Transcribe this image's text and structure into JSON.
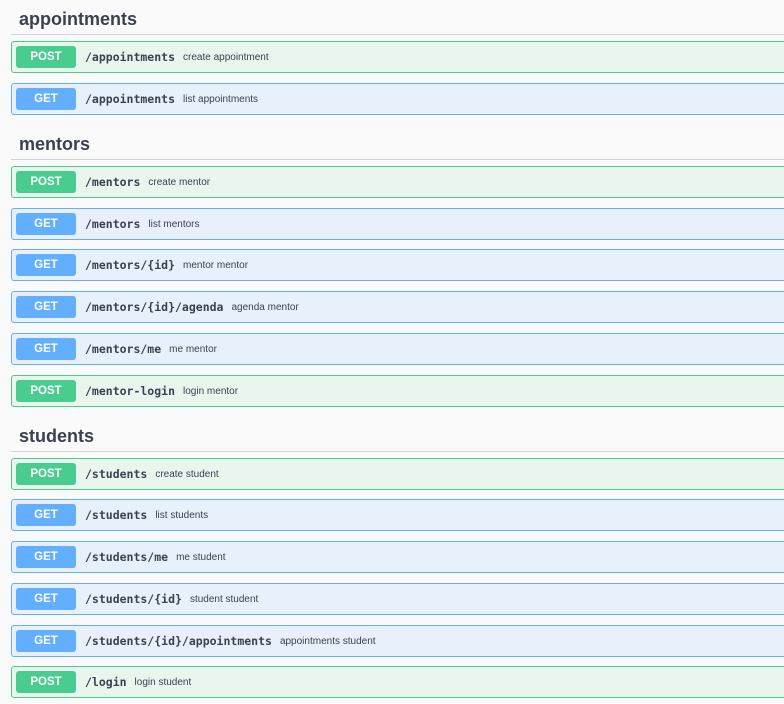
{
  "colors": {
    "post": "#49cc90",
    "post_bg": "#e8f6ee",
    "get": "#61affe",
    "get_bg": "#e8f0fb",
    "text": "#3b4151"
  },
  "groups": [
    {
      "title": "appointments",
      "operations": [
        {
          "method": "POST",
          "path": "/appointments",
          "summary": "create appointment"
        },
        {
          "method": "GET",
          "path": "/appointments",
          "summary": "list appointments"
        }
      ]
    },
    {
      "title": "mentors",
      "operations": [
        {
          "method": "POST",
          "path": "/mentors",
          "summary": "create mentor"
        },
        {
          "method": "GET",
          "path": "/mentors",
          "summary": "list mentors"
        },
        {
          "method": "GET",
          "path": "/mentors/{id}",
          "summary": "mentor mentor"
        },
        {
          "method": "GET",
          "path": "/mentors/{id}/agenda",
          "summary": "agenda mentor"
        },
        {
          "method": "GET",
          "path": "/mentors/me",
          "summary": "me mentor"
        },
        {
          "method": "POST",
          "path": "/mentor-login",
          "summary": "login mentor"
        }
      ]
    },
    {
      "title": "students",
      "operations": [
        {
          "method": "POST",
          "path": "/students",
          "summary": "create student"
        },
        {
          "method": "GET",
          "path": "/students",
          "summary": "list students"
        },
        {
          "method": "GET",
          "path": "/students/me",
          "summary": "me student"
        },
        {
          "method": "GET",
          "path": "/students/{id}",
          "summary": "student student"
        },
        {
          "method": "GET",
          "path": "/students/{id}/appointments",
          "summary": "appointments student"
        },
        {
          "method": "POST",
          "path": "/login",
          "summary": "login student"
        }
      ]
    }
  ]
}
